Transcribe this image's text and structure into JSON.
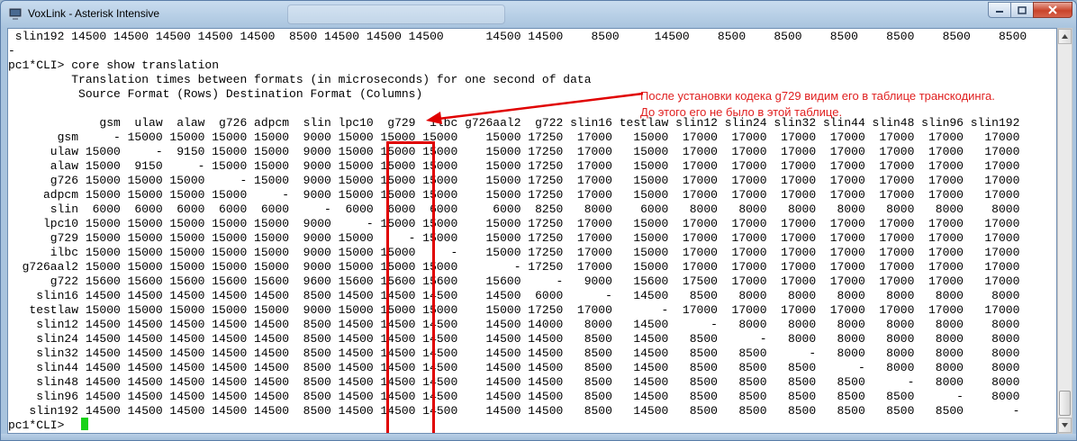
{
  "window": {
    "title": "VoxLink - Asterisk Intensive",
    "controls": {
      "minimize_icon": "minimize-icon",
      "maximize_icon": "maximize-icon",
      "close_icon": "close-icon"
    }
  },
  "console": {
    "top_row": " slin192 14500 14500 14500 14500 14500  8500 14500 14500 14500      14500 14500    8500     14500    8500    8500    8500    8500    8500    8500",
    "lines": [
      "-",
      "pc1*CLI> core show translation",
      "         Translation times between formats (in microseconds) for one second of data",
      "          Source Format (Rows) Destination Format (Columns)",
      "",
      "             gsm  ulaw  alaw  g726 adpcm  slin lpc10  g729  ilbc g726aal2  g722 slin16 testlaw slin12 slin24 slin32 slin44 slin48 slin96 slin192",
      "       gsm     - 15000 15000 15000 15000  9000 15000 15000 15000    15000 17250  17000   15000  17000  17000  17000  17000  17000  17000   17000",
      "      ulaw 15000     -  9150 15000 15000  9000 15000 15000 15000    15000 17250  17000   15000  17000  17000  17000  17000  17000  17000   17000",
      "      alaw 15000  9150     - 15000 15000  9000 15000 15000 15000    15000 17250  17000   15000  17000  17000  17000  17000  17000  17000   17000",
      "      g726 15000 15000 15000     - 15000  9000 15000 15000 15000    15000 17250  17000   15000  17000  17000  17000  17000  17000  17000   17000",
      "     adpcm 15000 15000 15000 15000     -  9000 15000 15000 15000    15000 17250  17000   15000  17000  17000  17000  17000  17000  17000   17000",
      "      slin  6000  6000  6000  6000  6000     -  6000  6000  6000     6000  8250   8000    6000   8000   8000   8000   8000   8000   8000    8000",
      "     lpc10 15000 15000 15000 15000 15000  9000     - 15000 15000    15000 17250  17000   15000  17000  17000  17000  17000  17000  17000   17000",
      "      g729 15000 15000 15000 15000 15000  9000 15000     - 15000    15000 17250  17000   15000  17000  17000  17000  17000  17000  17000   17000",
      "      ilbc 15000 15000 15000 15000 15000  9000 15000 15000     -    15000 17250  17000   15000  17000  17000  17000  17000  17000  17000   17000",
      "  g726aal2 15000 15000 15000 15000 15000  9000 15000 15000 15000        - 17250  17000   15000  17000  17000  17000  17000  17000  17000   17000",
      "      g722 15600 15600 15600 15600 15600  9600 15600 15600 15600    15600     -   9000   15600  17500  17000  17000  17000  17000  17000   17000",
      "    slin16 14500 14500 14500 14500 14500  8500 14500 14500 14500    14500  6000      -   14500   8500   8000   8000   8000   8000   8000    8000",
      "   testlaw 15000 15000 15000 15000 15000  9000 15000 15000 15000    15000 17250  17000       -  17000  17000  17000  17000  17000  17000   17000",
      "    slin12 14500 14500 14500 14500 14500  8500 14500 14500 14500    14500 14000   8000   14500      -   8000   8000   8000   8000   8000    8000",
      "    slin24 14500 14500 14500 14500 14500  8500 14500 14500 14500    14500 14500   8500   14500   8500      -   8000   8000   8000   8000    8000",
      "    slin32 14500 14500 14500 14500 14500  8500 14500 14500 14500    14500 14500   8500   14500   8500   8500      -   8000   8000   8000    8000",
      "    slin44 14500 14500 14500 14500 14500  8500 14500 14500 14500    14500 14500   8500   14500   8500   8500   8500      -   8000   8000    8000",
      "    slin48 14500 14500 14500 14500 14500  8500 14500 14500 14500    14500 14500   8500   14500   8500   8500   8500   8500      -   8000    8000",
      "    slin96 14500 14500 14500 14500 14500  8500 14500 14500 14500    14500 14500   8500   14500   8500   8500   8500   8500   8500      -    8000",
      "   slin192 14500 14500 14500 14500 14500  8500 14500 14500 14500    14500 14500   8500   14500   8500   8500   8500   8500   8500   8500       -",
      "pc1*CLI> "
    ]
  },
  "annotation": {
    "line1": "После установки кодека g729 видим его в таблице транскодинга.",
    "line2": "До этого его не было в этой таблице.",
    "color": "#e02020"
  },
  "colors": {
    "highlight": "#e00000",
    "cursor": "#19d219"
  }
}
